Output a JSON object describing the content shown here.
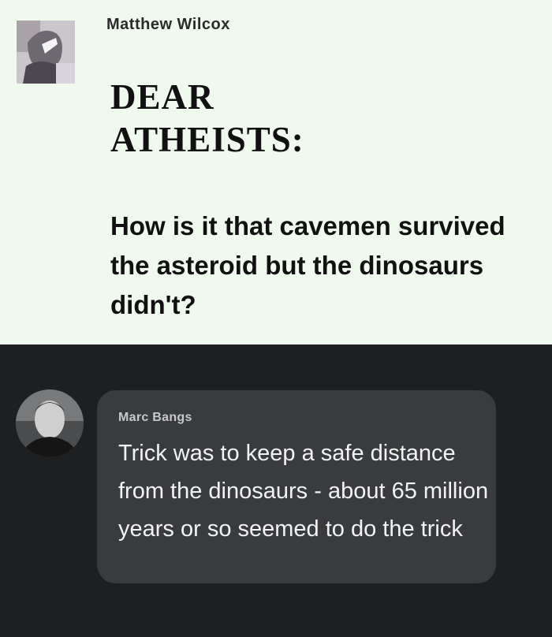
{
  "post": {
    "author": "Matthew Wilcox",
    "headline_line1": "DEAR",
    "headline_line2": "ATHEISTS:",
    "question": "How is it that cavemen survived the asteroid but the dinosaurs didn't?"
  },
  "comment": {
    "author": "Marc Bangs",
    "text": "Trick was to keep a safe distance from the dinosaurs - about 65 million years or so seemed to do the trick"
  },
  "colors": {
    "post_background": "#eff9ee",
    "comment_area_background": "#1d1f20",
    "comment_bubble": "#3a3b3c",
    "comment_text": "#f2f3f5"
  }
}
